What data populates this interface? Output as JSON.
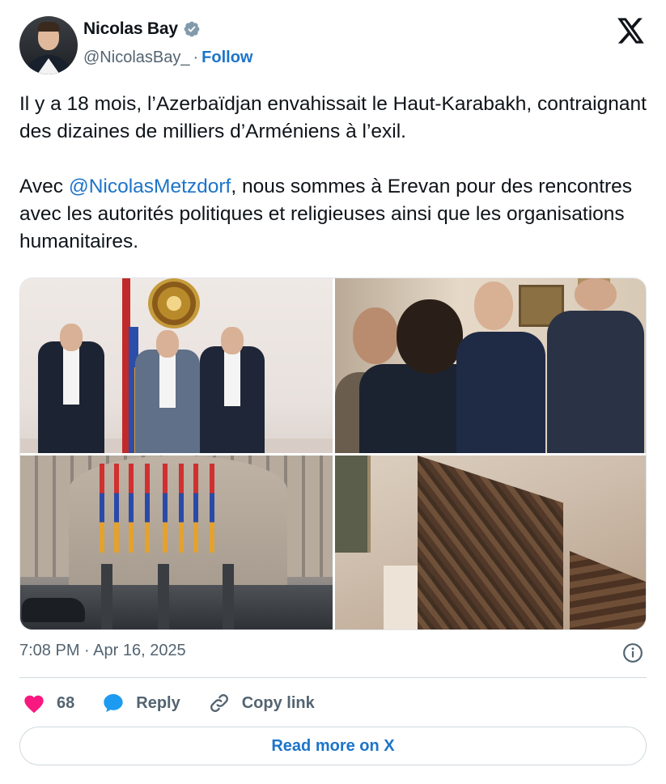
{
  "author": {
    "display_name": "Nicolas Bay",
    "handle": "@NicolasBay_",
    "separator": "·",
    "follow_label": "Follow",
    "verified": true
  },
  "tweet": {
    "paragraph1": "Il y a 18 mois, l’Azerbaïdjan envahissait le Haut-Karabakh, contraignant des dizaines de milliers d’Arméniens à l’exil.",
    "paragraph2_prefix": "Avec ",
    "mention": "@NicolasMetzdorf",
    "paragraph2_suffix": ", nous sommes à Erevan pour des rencontres avec les autorités politiques et religieuses ainsi que les organisations humanitaires."
  },
  "media": {
    "photos": [
      {
        "icon": "photo-meeting-flags"
      },
      {
        "icon": "photo-conversation"
      },
      {
        "icon": "photo-building-flags"
      },
      {
        "icon": "photo-relief-carving"
      }
    ]
  },
  "meta": {
    "timestamp": "7:08 PM · Apr 16, 2025"
  },
  "actions": {
    "like_count": "68",
    "reply_label": "Reply",
    "copy_link_label": "Copy link"
  },
  "read_more_label": "Read more on X",
  "colors": {
    "accent": "#1d74c9",
    "like": "#f91880",
    "reply_icon": "#1d9bf0",
    "muted": "#536471",
    "verified_badge": "#829aab"
  }
}
